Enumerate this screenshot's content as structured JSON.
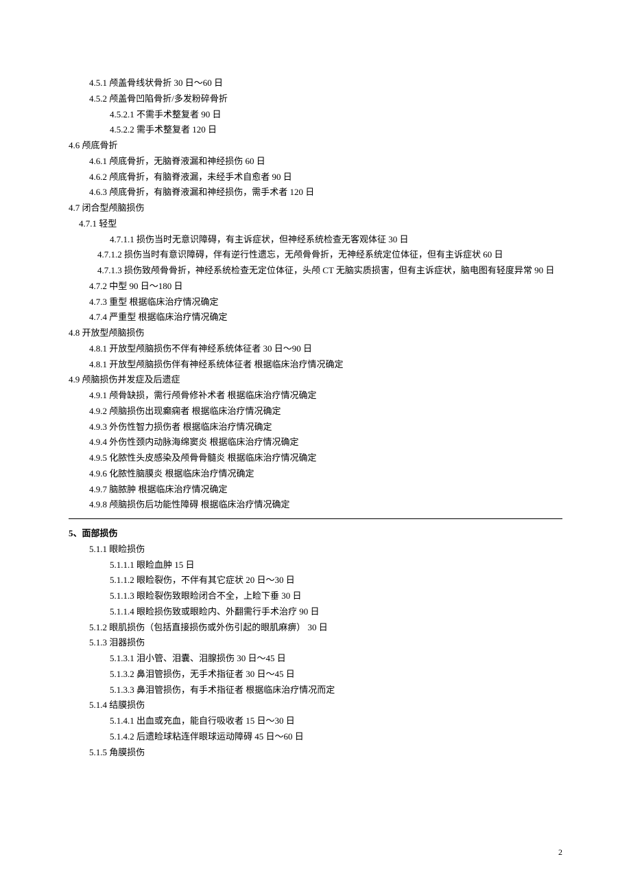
{
  "lines": [
    {
      "cls": "l2",
      "text": "4.5.1 颅盖骨线状骨折 30 日～60 日"
    },
    {
      "cls": "l2",
      "text": "4.5.2 颅盖骨凹陷骨折/多发粉碎骨折"
    },
    {
      "cls": "l3",
      "text": "4.5.2.1 不需手术整复者 90 日"
    },
    {
      "cls": "l3",
      "text": "4.5.2.2 需手术整复者 120 日"
    },
    {
      "cls": "l1",
      "text": "4.6 颅底骨折"
    },
    {
      "cls": "l2",
      "text": "4.6.1 颅底骨折，无脑脊液漏和神经损伤 60 日"
    },
    {
      "cls": "l2",
      "text": "4.6.2 颅底骨折，有脑脊液漏，未经手术自愈者 90 日"
    },
    {
      "cls": "l2",
      "text": "4.6.3 颅底骨折，有脑脊液漏和神经损伤，需手术者 120 日"
    },
    {
      "cls": "l1",
      "text": "4.7 闭合型颅脑损伤"
    },
    {
      "cls": "l2",
      "text": "4.7.1 轻型",
      "style": "margin-left:15px;"
    },
    {
      "cls": "l3",
      "text": "4.7.1.1 损伤当时无意识障碍，有主诉症状，但神经系统检查无客观体征 30 日"
    },
    {
      "cls": "l0",
      "text": "　　　　4.7.1.2 损伤当时有意识障碍，伴有逆行性遗忘，无颅骨骨折，无神经系统定位体征，但有主诉症状 60 日"
    },
    {
      "cls": "l0",
      "text": "　　　　4.7.1.3 损伤致颅骨骨折，神经系统检查无定位体征，头颅 CT 无脑实质损害，但有主诉症状，脑电图有轻度异常 90 日"
    },
    {
      "cls": "l2",
      "text": "4.7.2 中型 90 日～180 日"
    },
    {
      "cls": "l2",
      "text": "4.7.3 重型 根据临床治疗情况确定"
    },
    {
      "cls": "l2",
      "text": "4.7.4 严重型 根据临床治疗情况确定"
    },
    {
      "cls": "l1",
      "text": "4.8 开放型颅脑损伤"
    },
    {
      "cls": "l2",
      "text": "4.8.1 开放型颅脑损伤不伴有神经系统体征者 30 日～90 日"
    },
    {
      "cls": "l2",
      "text": "4.8.1 开放型颅脑损伤伴有神经系统体征者 根据临床治疗情况确定"
    },
    {
      "cls": "l1",
      "text": "4.9 颅脑损伤并发症及后遗症"
    },
    {
      "cls": "l2",
      "text": "4.9.1 颅骨缺损，需行颅骨修补术者 根据临床治疗情况确定"
    },
    {
      "cls": "l2",
      "text": "4.9.2 颅脑损伤出现癫痫者 根据临床治疗情况确定"
    },
    {
      "cls": "l2",
      "text": "4.9.3 外伤性智力损伤者 根据临床治疗情况确定"
    },
    {
      "cls": "l2",
      "text": "4.9.4 外伤性颈内动脉海绵窦炎 根据临床治疗情况确定"
    },
    {
      "cls": "l2",
      "text": "4.9.5 化脓性头皮感染及颅骨骨髓炎 根据临床治疗情况确定"
    },
    {
      "cls": "l2",
      "text": "4.9.6 化脓性脑膜炎 根据临床治疗情况确定"
    },
    {
      "cls": "l2",
      "text": "4.9.7 脑脓肿 根据临床治疗情况确定"
    },
    {
      "cls": "l2",
      "text": "4.9.8 颅脑损伤后功能性障碍 根据临床治疗情况确定"
    }
  ],
  "section5": {
    "heading": "5、面部损伤",
    "lines": [
      {
        "cls": "l2",
        "text": "5.1.1 眼睑损伤"
      },
      {
        "cls": "l3",
        "text": "5.1.1.1 眼睑血肿 15 日"
      },
      {
        "cls": "l3",
        "text": "5.1.1.2 眼睑裂伤，不伴有其它症状 20 日～30 日"
      },
      {
        "cls": "l3",
        "text": "5.1.1.3 眼睑裂伤致眼睑闭合不全，上睑下垂 30 日"
      },
      {
        "cls": "l3",
        "text": "5.1.1.4 眼睑损伤致或眼睑内、外翻需行手术治疗 90 日"
      },
      {
        "cls": "l2",
        "text": "5.1.2 眼肌损伤（包括直接损伤或外伤引起的眼肌麻痹） 30 日"
      },
      {
        "cls": "l2",
        "text": "5.1.3 泪器损伤"
      },
      {
        "cls": "l3",
        "text": "5.1.3.1 泪小管、泪囊、泪腺损伤 30 日～45 日"
      },
      {
        "cls": "l3",
        "text": "5.1.3.2 鼻泪管损伤，无手术指征者 30 日～45 日"
      },
      {
        "cls": "l3",
        "text": "5.1.3.3 鼻泪管损伤，有手术指征者 根据临床治疗情况而定"
      },
      {
        "cls": "l2",
        "text": "5.1.4 结膜损伤"
      },
      {
        "cls": "l3",
        "text": "5.1.4.1 出血或充血，能自行吸收者 15 日～30 日"
      },
      {
        "cls": "l3",
        "text": "5.1.4.2 后遗睑球粘连伴眼球运动障碍 45 日～60 日"
      },
      {
        "cls": "l2",
        "text": "5.1.5 角膜损伤"
      }
    ]
  },
  "pageNumber": "2"
}
